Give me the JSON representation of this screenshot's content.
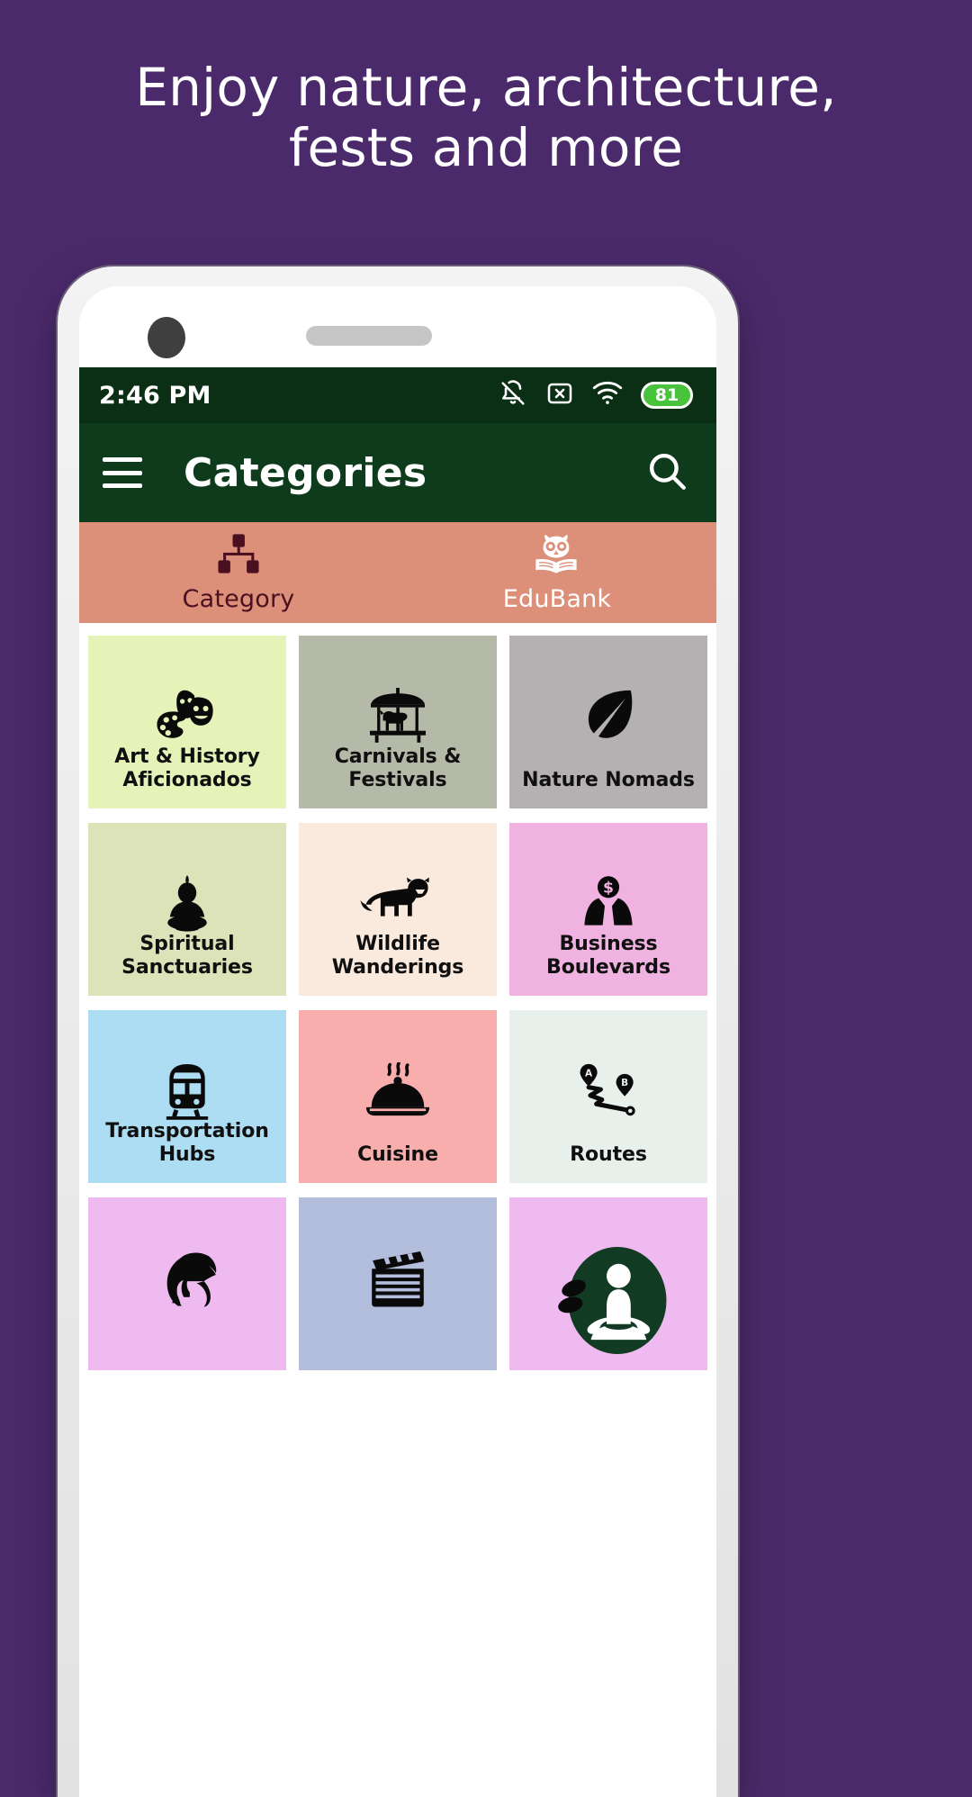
{
  "promo": {
    "line1": "Enjoy nature, architecture,",
    "line2": "fests and more",
    "background_color": "#4B2A6B",
    "text_color": "#FFFFFF"
  },
  "status_bar": {
    "time": "2:46 PM",
    "battery_level": "81",
    "background_color": "#0B2F14",
    "icons": [
      "notifications-off-icon",
      "no-sim-icon",
      "wifi-icon",
      "battery-icon"
    ]
  },
  "app_bar": {
    "title": "Categories",
    "menu_icon": "hamburger-menu-icon",
    "search_icon": "search-icon",
    "background_color": "#0E3B1B"
  },
  "tab_bar": {
    "background_color": "#DD9079",
    "selected_color": "#4A1020",
    "unselected_color": "#FFFFFF",
    "tabs": [
      {
        "label": "Category",
        "icon": "hierarchy-icon",
        "selected": true
      },
      {
        "label": "EduBank",
        "icon": "owl-book-icon",
        "selected": false
      }
    ]
  },
  "grid": {
    "cards": [
      {
        "label": "Art & History Aficionados",
        "icon": "theatre-masks-palette-icon",
        "color": "#E5F2B8"
      },
      {
        "label": "Carnivals & Festivals",
        "icon": "carousel-icon",
        "color": "#B5BAA8"
      },
      {
        "label": "Nature Nomads",
        "icon": "leaf-icon",
        "color": "#B5B0B2"
      },
      {
        "label": "Spiritual Sanctuaries",
        "icon": "buddha-icon",
        "color": "#DCE3B8"
      },
      {
        "label": "Wildlife Wanderings",
        "icon": "lion-icon",
        "color": "#FAEADD"
      },
      {
        "label": "Business Boulevards",
        "icon": "businessman-dollar-icon",
        "color": "#F0B2E0"
      },
      {
        "label": "Transportation Hubs",
        "icon": "train-icon",
        "color": "#ADDDF2"
      },
      {
        "label": "Cuisine",
        "icon": "food-cloche-icon",
        "color": "#F9AEAE"
      },
      {
        "label": "Routes",
        "icon": "route-a-b-icon",
        "color": "#E7F0EA"
      },
      {
        "label": "",
        "icon": "spartan-helmet-icon",
        "color": "#EEBAF0"
      },
      {
        "label": "",
        "icon": "clapperboard-icon",
        "color": "#B3BEDD"
      },
      {
        "label": "",
        "icon": "meditation-icon",
        "color": "#EEBAF0"
      }
    ]
  }
}
